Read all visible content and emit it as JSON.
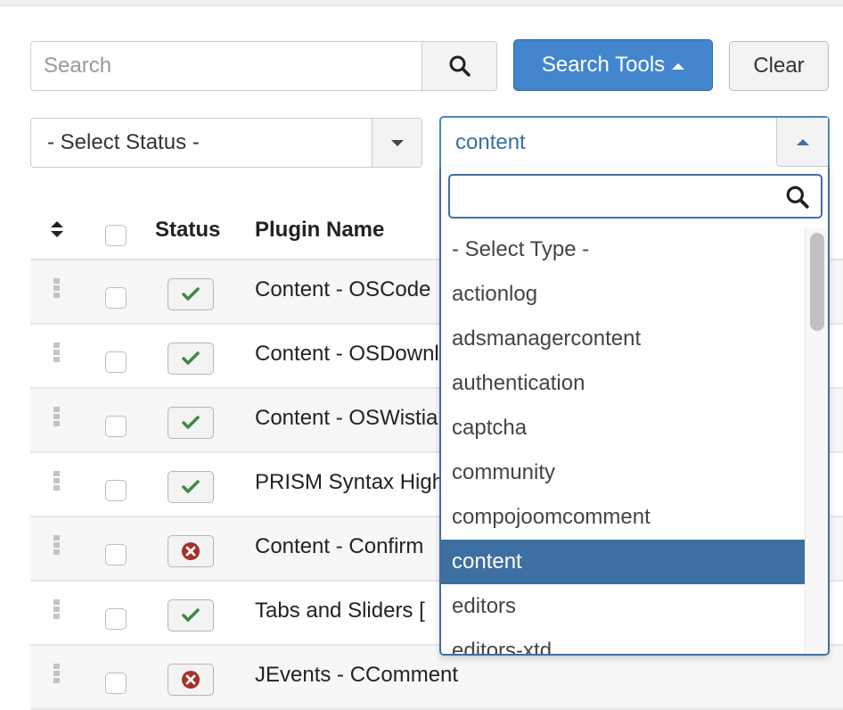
{
  "search": {
    "placeholder": "Search",
    "value": "",
    "search_button_icon": "search-icon",
    "tools_label": "Search Tools",
    "tools_icon": "caret-up-icon",
    "clear_label": "Clear"
  },
  "filters": {
    "status": {
      "selected": "- Select Status -",
      "icon": "caret-down-icon"
    },
    "type": {
      "selected": "content",
      "icon": "caret-up-icon",
      "search_value": "",
      "options": [
        "- Select Type -",
        "actionlog",
        "adsmanagercontent",
        "authentication",
        "captcha",
        "community",
        "compojoomcomment",
        "content",
        "editors",
        "editors-xtd"
      ],
      "highlighted_index": 7
    }
  },
  "table": {
    "columns": {
      "ordering_icon": "sort-icon",
      "status": "Status",
      "name": "Plugin Name"
    },
    "rows": [
      {
        "status": "enabled",
        "name": "Content - OSCode"
      },
      {
        "status": "enabled",
        "name": "Content - OSDownloads"
      },
      {
        "status": "enabled",
        "name": "Content - OSWistia"
      },
      {
        "status": "enabled",
        "name": "PRISM Syntax Highlighter"
      },
      {
        "status": "disabled",
        "name": "Content - Confirm"
      },
      {
        "status": "enabled",
        "name": "Tabs and Sliders ["
      },
      {
        "status": "disabled",
        "name": "JEvents - CComment"
      }
    ]
  },
  "colors": {
    "primary": "#4385cc",
    "selected_option": "#3d6fa2",
    "enabled_icon": "#3d8b3d",
    "disabled_icon": "#a3312c"
  }
}
